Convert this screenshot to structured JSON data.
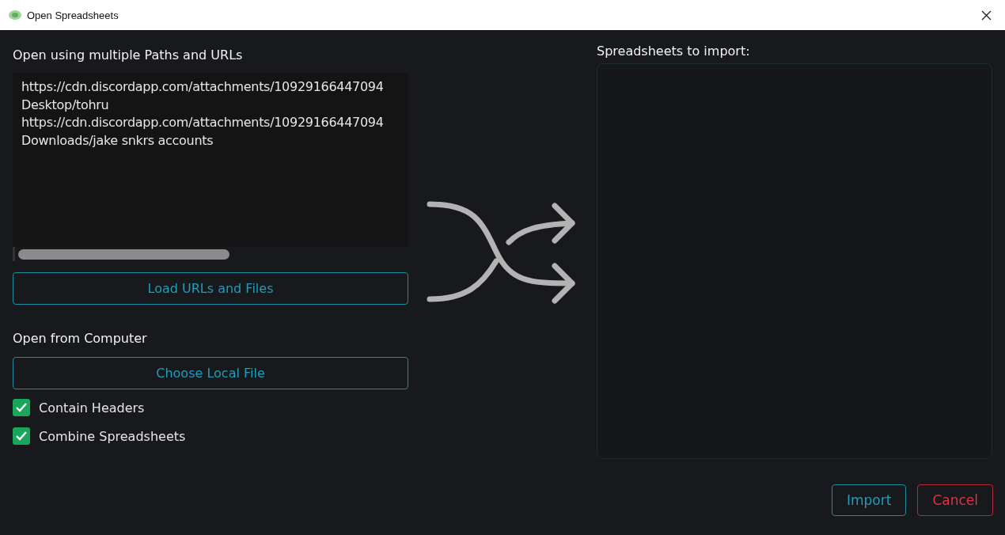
{
  "window": {
    "title": "Open Spreadsheets"
  },
  "paths": {
    "heading": "Open using multiple Paths and URLs",
    "lines": [
      "https://cdn.discordapp.com/attachments/10929166447094",
      "Desktop/tohru",
      "https://cdn.discordapp.com/attachments/10929166447094",
      "Downloads/jake snkrs accounts"
    ],
    "load_button": "Load URLs and Files"
  },
  "computer": {
    "heading": "Open from Computer",
    "button": "Choose Local File"
  },
  "options": [
    {
      "label": "Contain Headers",
      "checked": true
    },
    {
      "label": "Combine Spreadsheets",
      "checked": true
    }
  ],
  "import_list": {
    "heading": "Spreadsheets to import:"
  },
  "buttons": [
    {
      "label": "Import",
      "kind": "primary"
    },
    {
      "label": "Cancel",
      "kind": "danger"
    }
  ]
}
